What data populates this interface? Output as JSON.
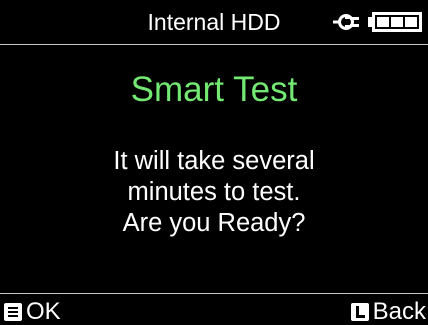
{
  "header": {
    "title": "Internal HDD",
    "power_icon": "power-plug-icon",
    "battery_icon": "battery-full-icon"
  },
  "dialog": {
    "title": "Smart Test",
    "message_lines": [
      "It will take several",
      "minutes to test.",
      "Are you Ready?"
    ]
  },
  "softkeys": {
    "left": {
      "icon": "menu-key-icon",
      "label": "OK"
    },
    "right": {
      "icon": "l-key-icon",
      "label": "Back"
    }
  },
  "colors": {
    "background": "#000000",
    "title_green": "#73e872",
    "text": "#ffffff",
    "divider": "#c8c8c8"
  }
}
